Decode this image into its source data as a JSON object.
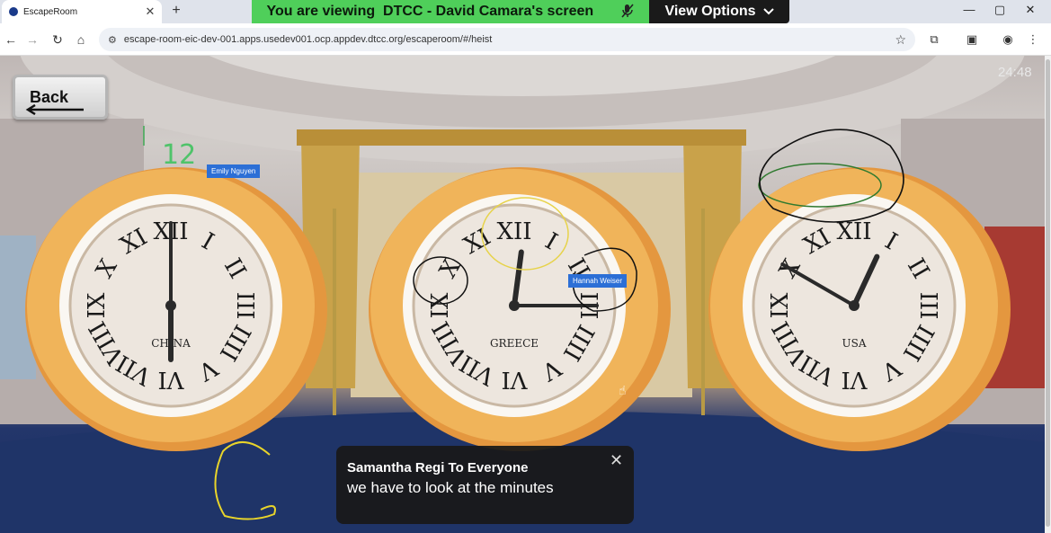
{
  "browser": {
    "tab_title": "EscapeRoom",
    "tab_close": "✕",
    "new_tab": "+",
    "url": "escape-room-eic-dev-001.apps.usedev001.ocp.appdev.dtcc.org/escaperoom/#/heist",
    "window_controls": [
      "—",
      "▢",
      "✕"
    ]
  },
  "screen_share": {
    "banner_text": "You are viewing  DTCC - David Camara's screen",
    "view_options_label": "View Options"
  },
  "game": {
    "back_label": "Back",
    "timer": "24:48",
    "clocks": [
      {
        "city": "CHINA",
        "time_hint": "6:00"
      },
      {
        "city": "GREECE",
        "time_hint": "12:15"
      },
      {
        "city": "USA",
        "time_hint": "12:50"
      }
    ],
    "numerals": [
      "XII",
      "I",
      "II",
      "III",
      "IIII",
      "V",
      "VI",
      "VII",
      "VIII",
      "IX",
      "X",
      "XI"
    ],
    "annotation_text": "12",
    "participant_tags": [
      "Emily Nguyen",
      "Hannah Weiser"
    ]
  },
  "chat": {
    "from": "Samantha Regi To Everyone",
    "message": "we have to look at the minutes",
    "close": "✕"
  },
  "colors": {
    "banner_green": "#4fcf5a",
    "clock_gold": "#f0b45a",
    "name_tag_blue": "#2c6fd6"
  }
}
